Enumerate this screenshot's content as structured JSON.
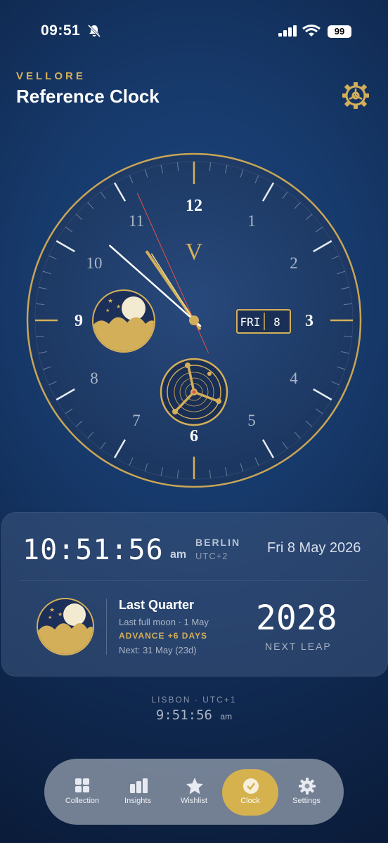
{
  "status_bar": {
    "time": "09:51",
    "battery": "99"
  },
  "header": {
    "brand": "VELLORE",
    "title": "Reference Clock"
  },
  "dial": {
    "numerals": [
      "12",
      "1",
      "2",
      "3",
      "4",
      "5",
      "6",
      "7",
      "8",
      "9",
      "10",
      "11"
    ],
    "logo": "V",
    "date_window": {
      "day": "FRI",
      "date": "8"
    },
    "hands": {
      "hour": 10,
      "minute": 51,
      "second": 56
    }
  },
  "info": {
    "time": "10:51:56",
    "ampm": "am",
    "city": "BERLIN",
    "utc": "UTC+2",
    "date": "Fri 8 May 2026",
    "moon": {
      "phase": "Last Quarter",
      "last_full": "Last full moon · 1 May",
      "advance": "ADVANCE +6 DAYS",
      "next": "Next: 31 May (23d)"
    },
    "leap": {
      "year": "2028",
      "label": "NEXT LEAP"
    }
  },
  "secondary": {
    "city_line": "LISBON · UTC+1",
    "time": "9:51:56",
    "ampm": "am"
  },
  "tabs": [
    {
      "label": "Collection",
      "icon": "grid-icon"
    },
    {
      "label": "Insights",
      "icon": "bar-chart-icon"
    },
    {
      "label": "Wishlist",
      "icon": "star-icon"
    },
    {
      "label": "Clock",
      "icon": "clock-icon",
      "active": true
    },
    {
      "label": "Settings",
      "icon": "gear-icon"
    }
  ],
  "colors": {
    "gold": "#d4af5a",
    "active_tab": "#d6b24e",
    "second_hand": "#e0504a"
  }
}
